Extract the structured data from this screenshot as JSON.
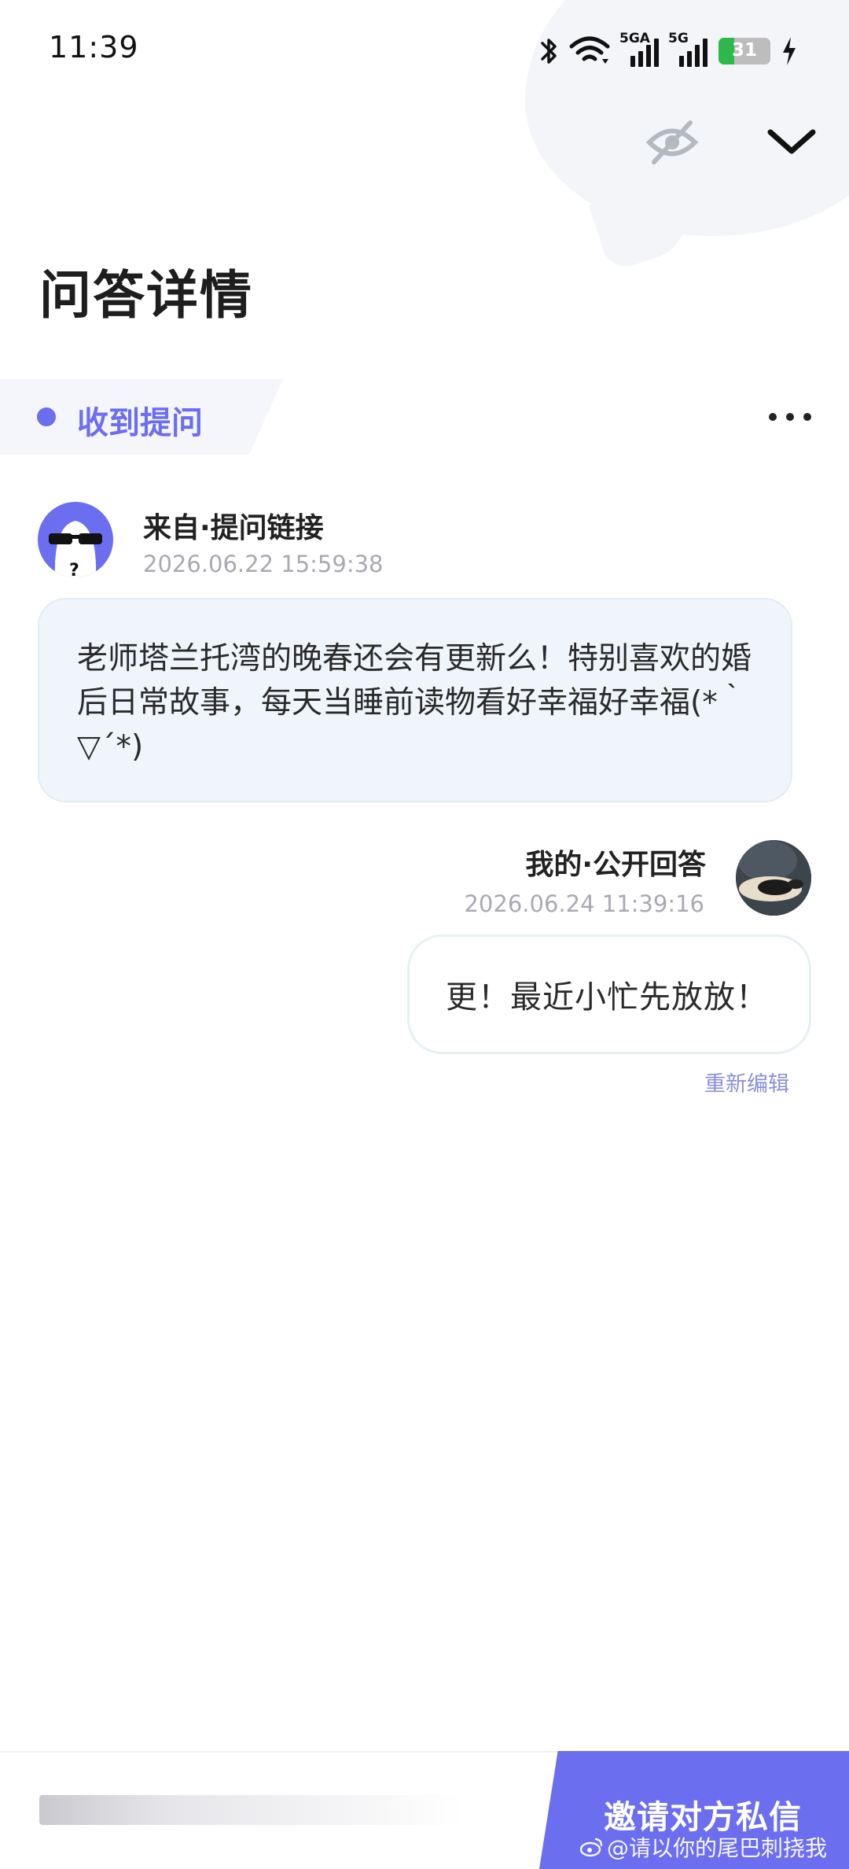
{
  "status_bar": {
    "time": "11:39",
    "signal_1_label": "5GA",
    "signal_2_label": "5G",
    "battery_level": "31",
    "battery_fraction": 0.31,
    "icons": [
      "bluetooth-icon",
      "wifi-icon",
      "signal-icon",
      "signal-icon",
      "battery-icon",
      "charging-icon"
    ]
  },
  "header": {
    "title": "问答详情",
    "hide_icon": "eye-off-icon",
    "collapse_icon": "chevron-down-icon"
  },
  "section": {
    "label": "收到提问",
    "accent": "#6c6ef0",
    "more_icon": "more-dots-icon"
  },
  "question": {
    "source": "来自·提问链接",
    "time": "2026.06.22 15:59:38",
    "text": "老师塔兰托湾的晚春还会有更新么！特别喜欢的婚后日常故事，每天当睡前读物看好幸福好幸福(*｀▽´*)"
  },
  "answer": {
    "source": "我的·公开回答",
    "time": "2026.06.24 11:39:16",
    "text": "更！最近小忙先放放！",
    "edit_label": "重新编辑"
  },
  "bottom": {
    "invite_label": "邀请对方私信",
    "watermark": "@请以你的尾巴刺挠我"
  }
}
